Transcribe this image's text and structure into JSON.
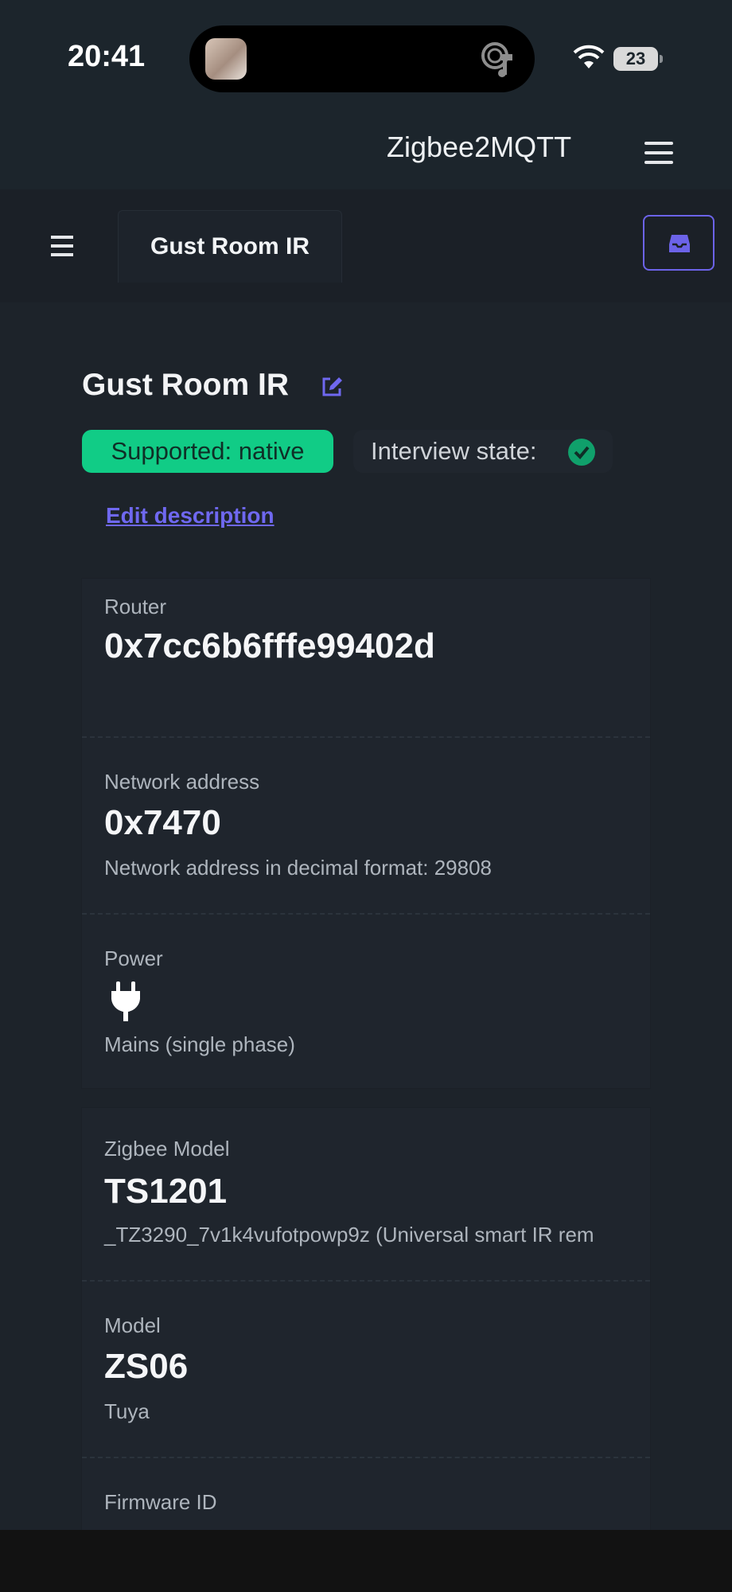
{
  "status_bar": {
    "time": "20:41",
    "battery": "23"
  },
  "app": {
    "title": "Zigbee2MQTT"
  },
  "nav": {
    "tab": "Gust Room IR"
  },
  "device": {
    "name": "Gust Room IR",
    "supported": "Supported: native",
    "interview_label": "Interview state:",
    "edit_description": "Edit description"
  },
  "info": [
    {
      "label": "Router",
      "value": "0x7cc6b6fffe99402d",
      "sub": ""
    },
    {
      "label": "Network address",
      "value": "0x7470",
      "sub": "Network address in decimal format: 29808"
    },
    {
      "label": "Power",
      "value": "",
      "sub": "Mains (single phase)"
    }
  ],
  "details": [
    {
      "label": "Zigbee Model",
      "value": "TS1201",
      "sub": "_TZ3290_7v1k4vufotpowp9z (Universal smart IR rem"
    },
    {
      "label": "Model",
      "value": "ZS06",
      "sub": "Tuya"
    },
    {
      "label": "Firmware ID",
      "value": "",
      "sub": ""
    }
  ],
  "colors": {
    "accent": "#6c63e8",
    "success": "#11cc86",
    "background": "#1d232a"
  }
}
